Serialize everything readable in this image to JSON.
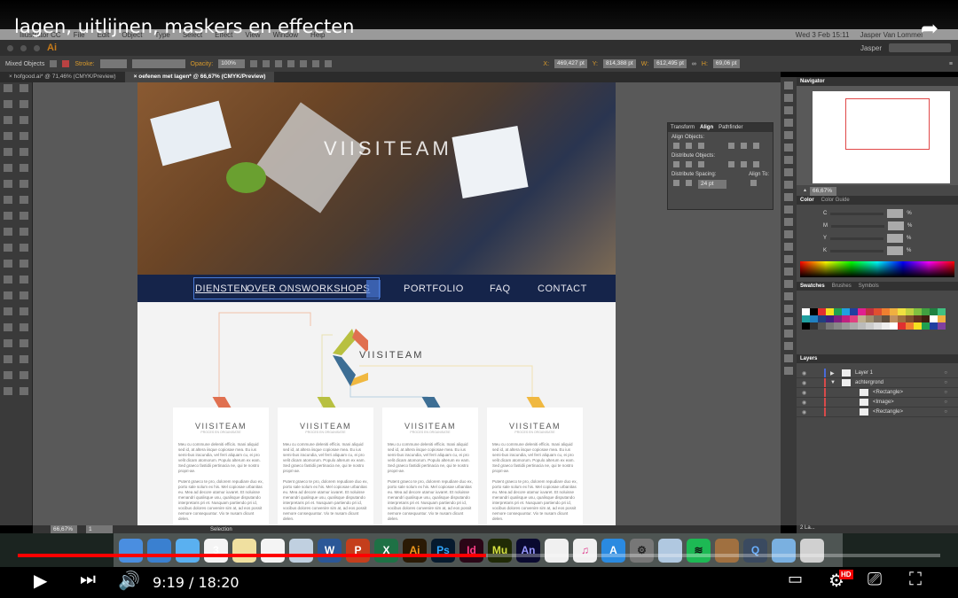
{
  "video": {
    "title": "lagen, uitlijnen, maskers en effecten",
    "time": "9:19 / 18:20",
    "progress": 0.508,
    "hd": "HD"
  },
  "menubar": {
    "items": [
      "Illustrator CC",
      "File",
      "Edit",
      "Object",
      "Type",
      "Select",
      "Effect",
      "View",
      "Window",
      "Help"
    ],
    "clock": "Wed 3 Feb  15:11",
    "user": "Jasper Van Lommel"
  },
  "app": {
    "logo": "Ai",
    "workspace": "Jasper"
  },
  "control": {
    "selection": "Mixed Objects",
    "stroke": "Stroke:",
    "opacity_label": "Opacity:",
    "opacity": "100%",
    "x_label": "X:",
    "x": "469,427 pt",
    "y_label": "Y:",
    "y": "814,388 pt",
    "w_label": "W:",
    "w": "612,495 pt",
    "h_label": "H:",
    "h": "69,06 pt"
  },
  "tabs": [
    {
      "label": "hofgood.ai* @ 71,46% (CMYK/Preview)"
    },
    {
      "label": "oefenen met lagen* @ 66,67% (CMYK/Preview)",
      "active": true
    }
  ],
  "artboard": {
    "brand": "VIISITEAM",
    "nav": [
      "DIENSTEN",
      "OVER ONS",
      "WORKSHOPS",
      "PORTFOLIO",
      "FAQ",
      "CONTACT"
    ],
    "logo_text": "VIISITEAM",
    "cards": [
      {
        "title": "VIISITEAM",
        "sub": "PROCES EN ORGANISATIE",
        "color": "#e07050"
      },
      {
        "title": "VIISITEAM",
        "sub": "PROCES EN ORGANISATIE",
        "color": "#b8c040"
      },
      {
        "title": "VIISITEAM",
        "sub": "PROCES EN ORGANISATIE",
        "color": "#3d6e94"
      },
      {
        "title": "VIISITEAM",
        "sub": "PROCES EN ORGANISATIE",
        "color": "#f0b840"
      }
    ],
    "body1": "Meu cu commune deleniti efficis. Inani aliquid sed id, at altera iisque copiosae mea. Eu ius semi-bus iracundia, vel ferri aliquam cu, ei pro velit dicam atomorum. Populo alterum ex eam. Sed graeco fastidii pertinacia ne, qui te nostro propri-ae.",
    "body2": "Putent graeco te pro, dolorem repudiare duo ex, porto sale solum ex his. Mel copiosae urbanitas eu. Mea ad decore utamur iuvaret. Et noluisse menandri qualisque usu, qualisque disputando interpretaris pri et. Nusquam partiendo pri id, vocibus dolores convenire sim at, ad eos possit nemore consequuntur. Vix te nusam dicunt delen."
  },
  "align_panel": {
    "tabs": [
      "Transform",
      "Align",
      "Pathfinder"
    ],
    "align_objects": "Align Objects:",
    "distribute_objects": "Distribute Objects:",
    "distribute_spacing": "Distribute Spacing:",
    "align_to": "Align To:",
    "spacing": "24 pt"
  },
  "navigator": {
    "title": "Navigator",
    "zoom": "66,67%"
  },
  "color": {
    "tabs": [
      "Color",
      "Color Guide"
    ],
    "channels": [
      "C",
      "M",
      "Y",
      "K"
    ],
    "unit": "%"
  },
  "swatches": {
    "tabs": [
      "Swatches",
      "Brushes",
      "Symbols"
    ],
    "colors": [
      "#ffffff",
      "#000000",
      "#e03030",
      "#f5e020",
      "#20a050",
      "#20a0e0",
      "#2040a0",
      "#e02090",
      "#c03040",
      "#e05030",
      "#f08030",
      "#f0b040",
      "#f0e040",
      "#c0d040",
      "#80c040",
      "#40a040",
      "#208040",
      "#40c080",
      "#20a0a0",
      "#2080c0",
      "#204080",
      "#402080",
      "#802080",
      "#c02080",
      "#e04080",
      "#c0b090",
      "#a09070",
      "#807060",
      "#605040",
      "#c09060",
      "#a07040",
      "#805030",
      "#603020",
      "#402010",
      "#ffffff",
      "#f0b040",
      "#000000",
      "#333333",
      "#555555",
      "#777777",
      "#888888",
      "#999999",
      "#aaaaaa",
      "#bbbbbb",
      "#cccccc",
      "#dddddd",
      "#eeeeee",
      "#ffffff",
      "#e03030",
      "#f08030",
      "#f5e020",
      "#20a050",
      "#2040a0",
      "#8040a0"
    ]
  },
  "layers": {
    "title": "Layers",
    "items": [
      {
        "name": "Layer 1",
        "color": "#4a6ad8",
        "indent": 0,
        "arrow": "▶"
      },
      {
        "name": "achtergrond",
        "color": "#d84a4a",
        "indent": 0,
        "arrow": "▼"
      },
      {
        "name": "<Rectangle>",
        "color": "#d84a4a",
        "indent": 1
      },
      {
        "name": "<Image>",
        "color": "#d84a4a",
        "indent": 1
      },
      {
        "name": "<Rectangle>",
        "color": "#d84a4a",
        "indent": 1
      }
    ],
    "count": "2 La..."
  },
  "status": {
    "zoom": "66,67%",
    "page": "1",
    "tool": "Selection"
  },
  "dock": [
    {
      "name": "finder",
      "bg": "#4a8ee0",
      "t": ""
    },
    {
      "name": "safari",
      "bg": "#3a80d0",
      "t": ""
    },
    {
      "name": "messages",
      "bg": "#5ab0f0",
      "t": ""
    },
    {
      "name": "calendar",
      "bg": "#f4f4f4",
      "t": "3"
    },
    {
      "name": "notes",
      "bg": "#f0e0a0",
      "t": ""
    },
    {
      "name": "reminders",
      "bg": "#f4f4f4",
      "t": ""
    },
    {
      "name": "preview",
      "bg": "#c0d0e0",
      "t": ""
    },
    {
      "name": "word",
      "bg": "#2b5797",
      "t": "W"
    },
    {
      "name": "powerpoint",
      "bg": "#c43e1c",
      "t": "P"
    },
    {
      "name": "excel",
      "bg": "#1e7145",
      "t": "X"
    },
    {
      "name": "illustrator",
      "bg": "#2a1a05",
      "t": "Ai",
      "c": "#f29a1a"
    },
    {
      "name": "photoshop",
      "bg": "#061a2e",
      "t": "Ps",
      "c": "#31a8ff"
    },
    {
      "name": "indesign",
      "bg": "#2a0616",
      "t": "Id",
      "c": "#ff3d87"
    },
    {
      "name": "muse",
      "bg": "#202a06",
      "t": "Mu",
      "c": "#d4e040"
    },
    {
      "name": "animate",
      "bg": "#0a0a30",
      "t": "An",
      "c": "#9999ff"
    },
    {
      "name": "photos",
      "bg": "#f0f0f0",
      "t": ""
    },
    {
      "name": "itunes",
      "bg": "#f0f0f0",
      "t": "♫",
      "c": "#e04090"
    },
    {
      "name": "app-store",
      "bg": "#2a8ae0",
      "t": "A",
      "c": "#fff"
    },
    {
      "name": "system-preferences",
      "bg": "#777",
      "t": "⚙",
      "c": "#222"
    },
    {
      "name": "mail-preview",
      "bg": "#b0c8e0",
      "t": ""
    },
    {
      "name": "spotify",
      "bg": "#1db954",
      "t": "≋",
      "c": "#111"
    },
    {
      "name": "garageband",
      "bg": "#a07040",
      "t": ""
    },
    {
      "name": "quicktime",
      "bg": "#3a4a60",
      "t": "Q",
      "c": "#6ab0ff"
    },
    {
      "name": "downloads",
      "bg": "#7ab0e0",
      "t": ""
    },
    {
      "name": "trash",
      "bg": "#d0d0d0",
      "t": ""
    }
  ]
}
